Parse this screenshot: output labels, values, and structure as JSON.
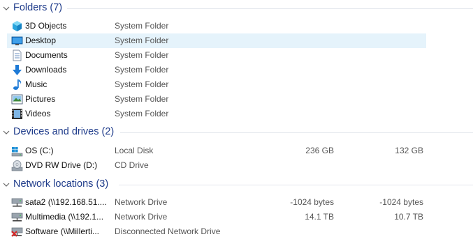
{
  "groups": {
    "folders": {
      "title": "Folders (7)",
      "items": [
        {
          "name": "3D Objects",
          "type": "System Folder",
          "icon": "3d-objects-icon"
        },
        {
          "name": "Desktop",
          "type": "System Folder",
          "icon": "desktop-icon",
          "selected": true
        },
        {
          "name": "Documents",
          "type": "System Folder",
          "icon": "documents-icon"
        },
        {
          "name": "Downloads",
          "type": "System Folder",
          "icon": "downloads-icon"
        },
        {
          "name": "Music",
          "type": "System Folder",
          "icon": "music-icon"
        },
        {
          "name": "Pictures",
          "type": "System Folder",
          "icon": "pictures-icon"
        },
        {
          "name": "Videos",
          "type": "System Folder",
          "icon": "videos-icon"
        }
      ]
    },
    "devices": {
      "title": "Devices and drives (2)",
      "items": [
        {
          "name": "OS (C:)",
          "type": "Local Disk",
          "total": "236 GB",
          "free": "132 GB",
          "icon": "windows-drive-icon"
        },
        {
          "name": "DVD RW Drive (D:)",
          "type": "CD Drive",
          "icon": "dvd-drive-icon"
        }
      ]
    },
    "network": {
      "title": "Network locations (3)",
      "items": [
        {
          "name": "sata2 (\\\\192.168.51....",
          "type": "Network Drive",
          "total": "-1024 bytes",
          "free": "-1024 bytes",
          "icon": "network-drive-icon"
        },
        {
          "name": "Multimedia (\\\\192.1...",
          "type": "Network Drive",
          "total": "14.1 TB",
          "free": "10.7 TB",
          "icon": "network-drive-icon"
        },
        {
          "name": "Software (\\\\Millerti...",
          "type": "Disconnected Network Drive",
          "icon": "disconnected-network-drive-icon"
        }
      ]
    }
  },
  "colors": {
    "group_title": "#1e3b8a",
    "selection": "#e5f3fb",
    "disconnected": "#d62828"
  }
}
